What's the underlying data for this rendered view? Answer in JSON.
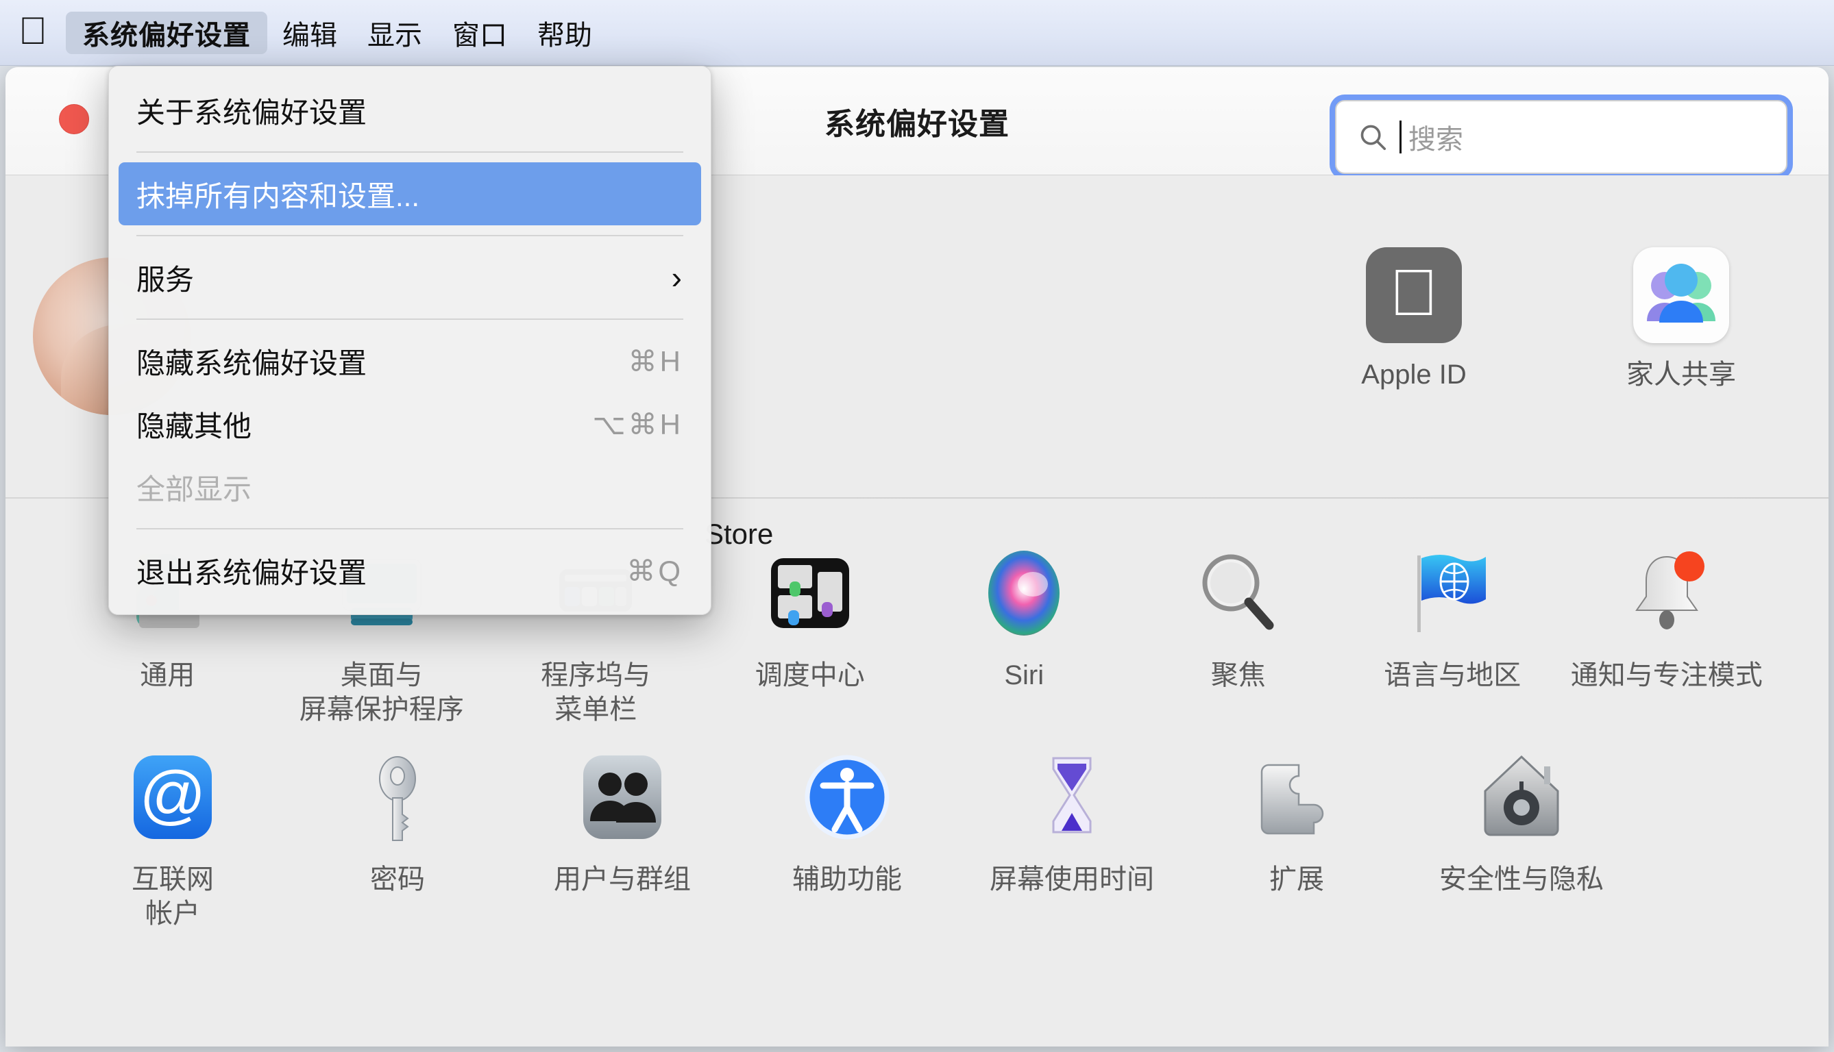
{
  "menubar": {
    "apple_icon": "apple-logo-icon",
    "app_menu": "系统偏好设置",
    "items": [
      "编辑",
      "显示",
      "窗口",
      "帮助"
    ]
  },
  "dropdown": {
    "groups": [
      {
        "items": [
          {
            "label": "关于系统偏好设置",
            "shortcut": "",
            "state": "normal",
            "submenu": false
          }
        ]
      },
      {
        "items": [
          {
            "label": "抹掉所有内容和设置...",
            "shortcut": "",
            "state": "selected",
            "submenu": false
          }
        ]
      },
      {
        "items": [
          {
            "label": "服务",
            "shortcut": "",
            "state": "normal",
            "submenu": true
          }
        ]
      },
      {
        "items": [
          {
            "label": "隐藏系统偏好设置",
            "shortcut": "⌘H",
            "state": "normal",
            "submenu": false
          },
          {
            "label": "隐藏其他",
            "shortcut": "⌥⌘H",
            "state": "normal",
            "submenu": false
          },
          {
            "label": "全部显示",
            "shortcut": "",
            "state": "disabled",
            "submenu": false
          }
        ]
      },
      {
        "items": [
          {
            "label": "退出系统偏好设置",
            "shortcut": "⌘Q",
            "state": "normal",
            "submenu": false
          }
        ]
      }
    ]
  },
  "window": {
    "title": "系统偏好设置",
    "close_button": "close-window-button",
    "search": {
      "placeholder": "搜索",
      "value": "",
      "icon": "search-icon",
      "focused": true
    },
    "store_label": "Store",
    "avatar": "user-avatar"
  },
  "account_tiles": [
    {
      "label": "Apple ID",
      "icon": "apple-id-icon"
    },
    {
      "label": "家人共享",
      "icon": "family-sharing-icon"
    }
  ],
  "pref_rows": [
    [
      {
        "label": "通用",
        "icon": "general-icon"
      },
      {
        "label": "桌面与\n屏幕保护程序",
        "icon": "desktop-screensaver-icon"
      },
      {
        "label": "程序坞与\n菜单栏",
        "icon": "dock-menubar-icon"
      },
      {
        "label": "调度中心",
        "icon": "mission-control-icon"
      },
      {
        "label": "Siri",
        "icon": "siri-icon"
      },
      {
        "label": "聚焦",
        "icon": "spotlight-icon"
      },
      {
        "label": "语言与地区",
        "icon": "language-region-icon"
      },
      {
        "label": "通知与专注模式",
        "icon": "notifications-focus-icon"
      }
    ],
    [
      {
        "label": "互联网\n帐户",
        "icon": "internet-accounts-icon"
      },
      {
        "label": "密码",
        "icon": "passwords-icon"
      },
      {
        "label": "用户与群组",
        "icon": "users-groups-icon"
      },
      {
        "label": "辅助功能",
        "icon": "accessibility-icon"
      },
      {
        "label": "屏幕使用时间",
        "icon": "screen-time-icon"
      },
      {
        "label": "扩展",
        "icon": "extensions-icon"
      },
      {
        "label": "安全性与隐私",
        "icon": "security-privacy-icon"
      }
    ]
  ],
  "colors": {
    "menu_highlight": "#6d9eeb",
    "search_focus_ring": "#6a96f6",
    "close_button": "#f0584f",
    "badge_red": "#f6441f",
    "accent_blue": "#2d7df6"
  }
}
